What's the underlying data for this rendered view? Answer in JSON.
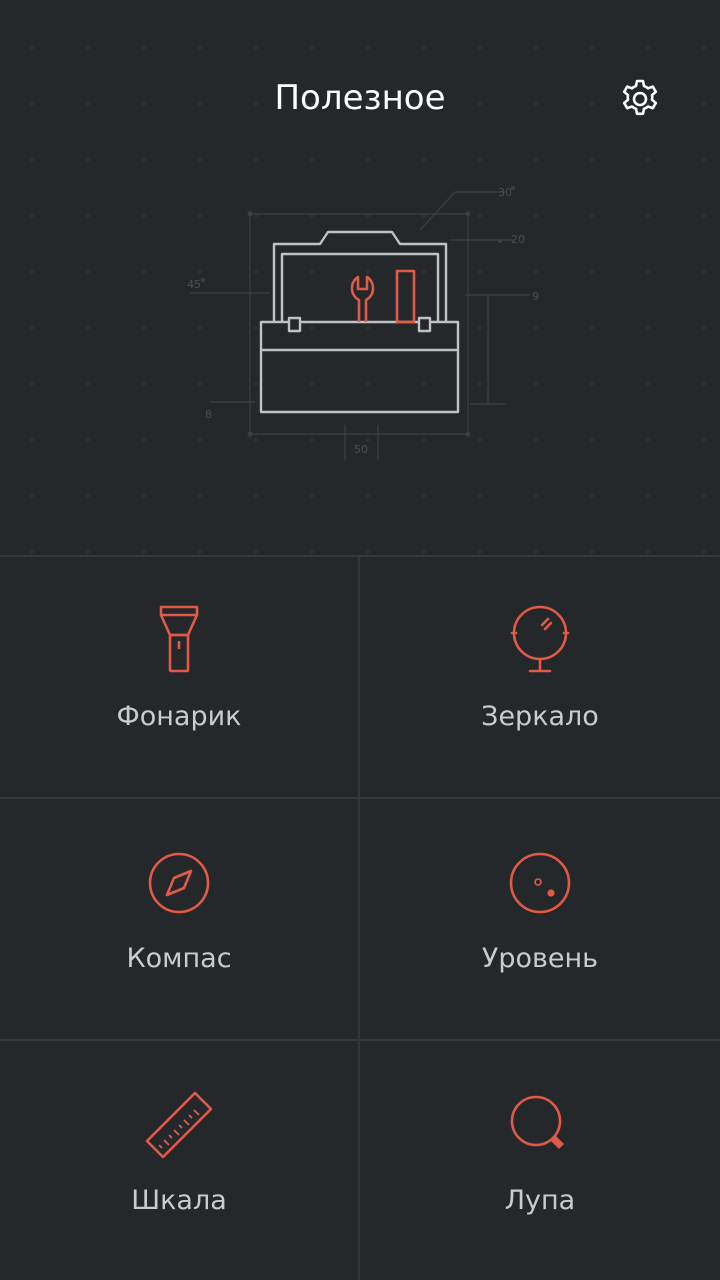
{
  "header": {
    "title": "Полезное"
  },
  "illustration": {
    "dimension_labels": [
      "30",
      "20",
      "45",
      "9",
      "8",
      "50"
    ]
  },
  "tools": [
    {
      "label": "Фонарик",
      "icon": "flashlight-icon"
    },
    {
      "label": "Зеркало",
      "icon": "mirror-icon"
    },
    {
      "label": "Компас",
      "icon": "compass-icon"
    },
    {
      "label": "Уровень",
      "icon": "level-icon"
    },
    {
      "label": "Шкала",
      "icon": "ruler-icon"
    },
    {
      "label": "Лупа",
      "icon": "magnifier-icon"
    }
  ],
  "colors": {
    "background": "#25282b",
    "accent": "#e05a47",
    "divider": "#34383c",
    "label": "#c9cccf"
  }
}
